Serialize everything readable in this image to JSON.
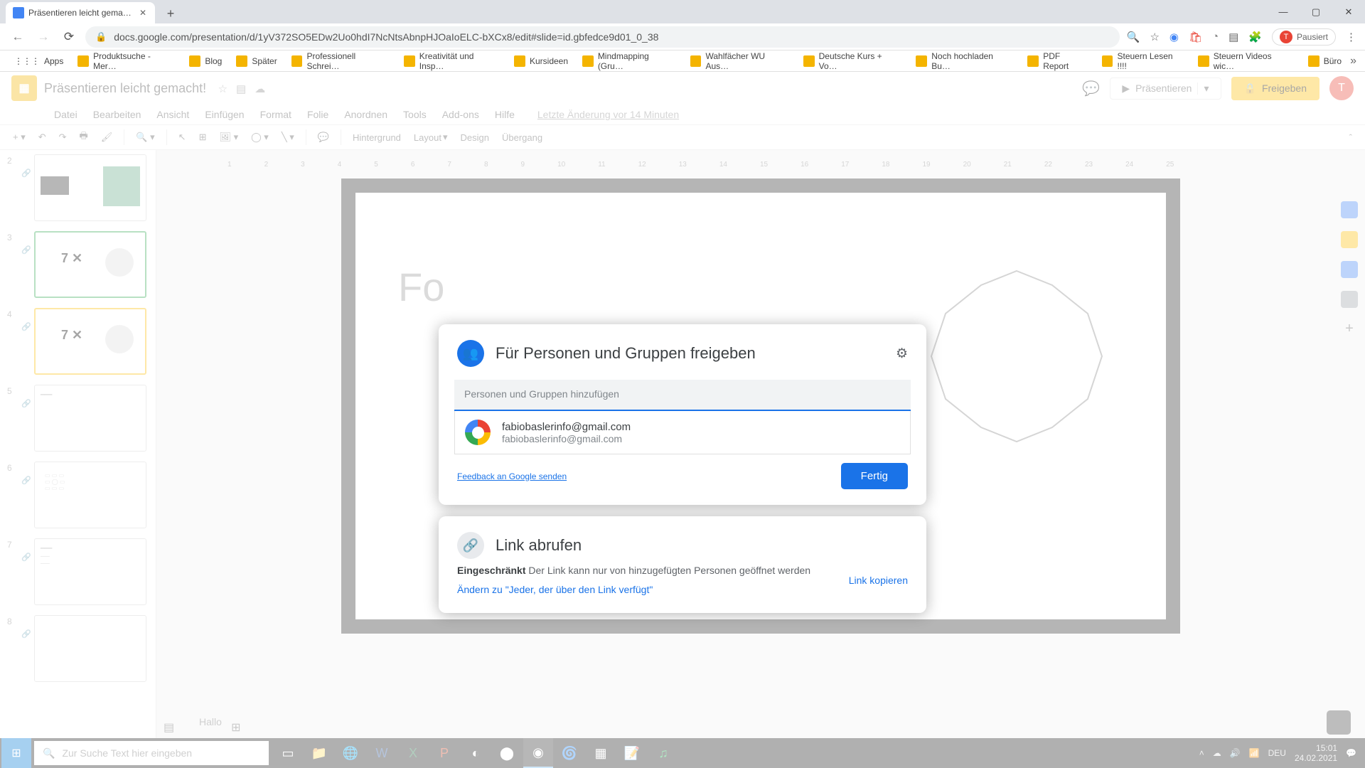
{
  "browser": {
    "tab_title": "Präsentieren leicht gemacht! - G",
    "url": "docs.google.com/presentation/d/1yV372SO5EDw2Uo0hdI7NcNtsAbnpHJOaIoELC-bXCx8/edit#slide=id.gbfedce9d01_0_38",
    "profile_label": "Pausiert",
    "bookmarks": [
      "Apps",
      "Produktsuche - Mer…",
      "Blog",
      "Später",
      "Professionell Schrei…",
      "Kreativität und Insp…",
      "Kursideen",
      "Mindmapping (Gru…",
      "Wahlfächer WU Aus…",
      "Deutsche Kurs + Vo…",
      "Noch hochladen Bu…",
      "PDF Report",
      "Steuern Lesen !!!!",
      "Steuern Videos wic…",
      "Büro"
    ]
  },
  "slides": {
    "doc_title": "Präsentieren leicht gemacht!",
    "menus": [
      "Datei",
      "Bearbeiten",
      "Ansicht",
      "Einfügen",
      "Format",
      "Folie",
      "Anordnen",
      "Tools",
      "Add-ons",
      "Hilfe"
    ],
    "last_edit": "Letzte Änderung vor 14 Minuten",
    "present_label": "Präsentieren",
    "share_label": "Freigeben",
    "toolbar": {
      "background": "Hintergrund",
      "layout": "Layout",
      "design": "Design",
      "transition": "Übergang"
    },
    "ruler": [
      "1",
      "2",
      "3",
      "4",
      "5",
      "6",
      "7",
      "8",
      "9",
      "10",
      "11",
      "12",
      "13",
      "14",
      "15",
      "16",
      "17",
      "18",
      "19",
      "20",
      "21",
      "22",
      "23",
      "24",
      "25"
    ],
    "slide_partial_text": "Fo",
    "notes_text": "Hallo",
    "thumbnails": [
      {
        "num": "2",
        "content": ""
      },
      {
        "num": "3",
        "content": "7 ✕"
      },
      {
        "num": "4",
        "content": "7 ✕"
      },
      {
        "num": "5",
        "content": ""
      },
      {
        "num": "6",
        "content": ""
      },
      {
        "num": "7",
        "content": ""
      },
      {
        "num": "8",
        "content": ""
      }
    ]
  },
  "share": {
    "title": "Für Personen und Gruppen freigeben",
    "input_placeholder": "Personen und Gruppen hinzufügen",
    "suggestion_name": "fabiobaslerinfo@gmail.com",
    "suggestion_email": "fabiobaslerinfo@gmail.com",
    "feedback": "Feedback an Google senden",
    "done": "Fertig",
    "link_title": "Link abrufen",
    "restricted_bold": "Eingeschränkt",
    "restricted_rest": " Der Link kann nur von hinzugefügten Personen geöffnet werden",
    "copy_link": "Link kopieren",
    "change_link": "Ändern zu \"Jeder, der über den Link verfügt\""
  },
  "taskbar": {
    "search_placeholder": "Zur Suche Text hier eingeben",
    "lang": "DEU",
    "time": "15:01",
    "date": "24.02.2021"
  }
}
